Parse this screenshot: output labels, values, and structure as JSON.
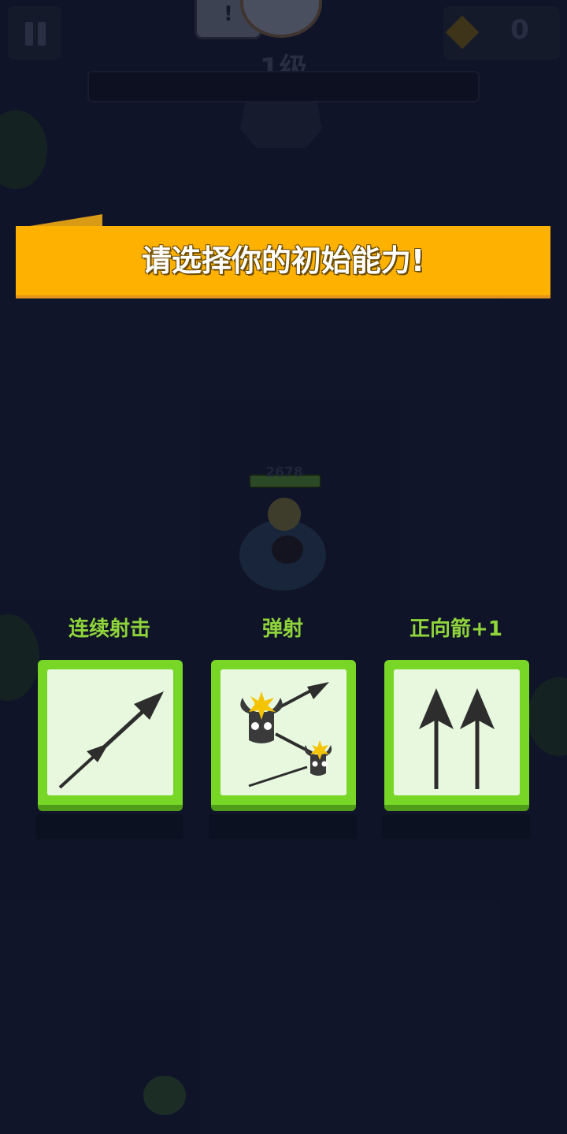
{
  "hud": {
    "level": "1级",
    "gems": "0",
    "speech_mark": "!"
  },
  "banner": {
    "text": "请选择你的初始能力!"
  },
  "hero": {
    "hp": "2678"
  },
  "abilities": [
    {
      "label": "连续射击",
      "icon": "double-arrow-icon"
    },
    {
      "label": "弹射",
      "icon": "ricochet-icon"
    },
    {
      "label": "正向箭+1",
      "icon": "front-arrow-plus-one-icon"
    }
  ],
  "colors": {
    "banner": "#ffb100",
    "card_green": "#78d627",
    "card_face": "#e8f8de",
    "label_green": "#8fd43a",
    "arrow": "#2d2d2d"
  }
}
